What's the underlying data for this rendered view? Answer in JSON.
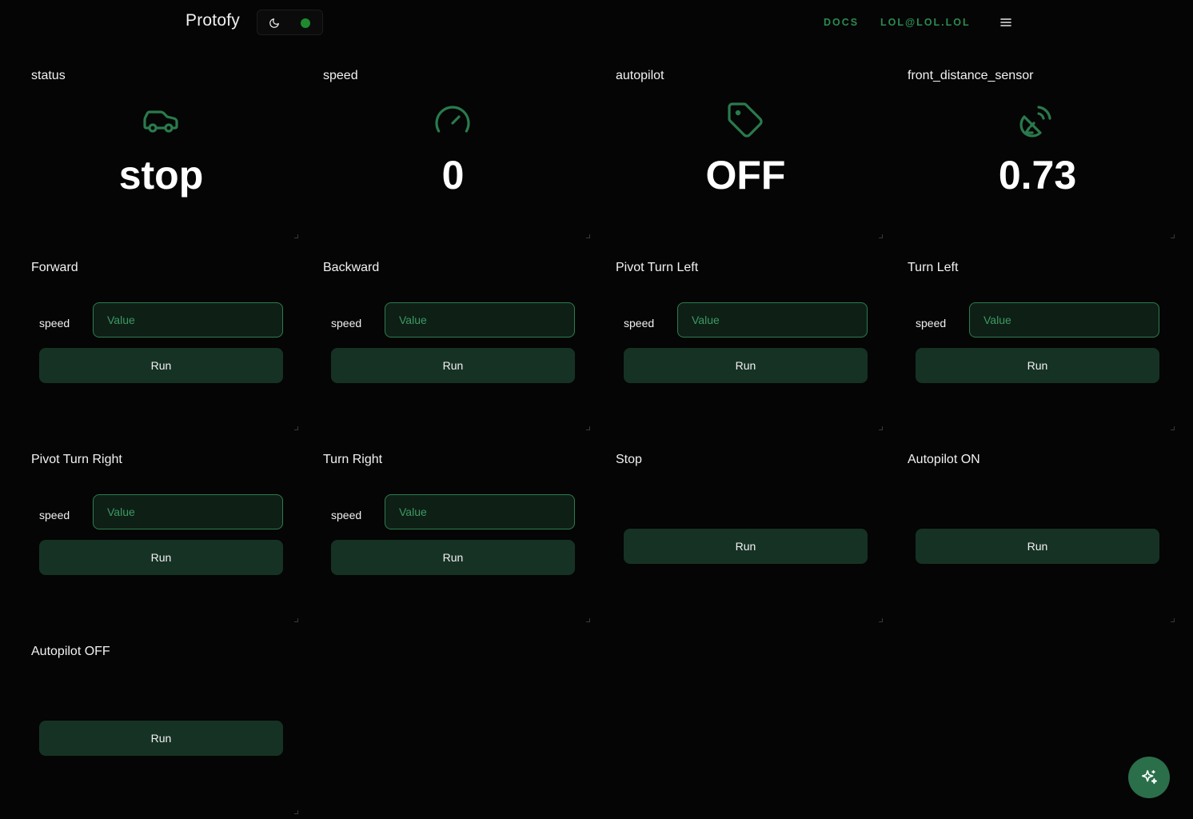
{
  "header": {
    "brand": "Protofy",
    "nav": {
      "docs": "DOCS",
      "user": "LOL@LOL.LOL"
    },
    "icons": {
      "theme": "moon-icon",
      "status": "green-status-dot",
      "menu": "hamburger-menu-icon"
    },
    "status_color": "#1f8a2e"
  },
  "value_cards": [
    {
      "title": "status",
      "icon": "car-icon",
      "value": "stop"
    },
    {
      "title": "speed",
      "icon": "gauge-icon",
      "value": "0"
    },
    {
      "title": "autopilot",
      "icon": "tag-icon",
      "value": "OFF"
    },
    {
      "title": "front_distance_sensor",
      "icon": "satellite-dish-icon",
      "value": "0.73"
    }
  ],
  "action_cards": [
    {
      "title": "Forward",
      "param_label": "speed",
      "placeholder": "Value",
      "run_label": "Run"
    },
    {
      "title": "Backward",
      "param_label": "speed",
      "placeholder": "Value",
      "run_label": "Run"
    },
    {
      "title": "Pivot Turn Left",
      "param_label": "speed",
      "placeholder": "Value",
      "run_label": "Run"
    },
    {
      "title": "Turn Left",
      "param_label": "speed",
      "placeholder": "Value",
      "run_label": "Run"
    },
    {
      "title": "Pivot Turn Right",
      "param_label": "speed",
      "placeholder": "Value",
      "run_label": "Run"
    },
    {
      "title": "Turn Right",
      "param_label": "speed",
      "placeholder": "Value",
      "run_label": "Run"
    },
    {
      "title": "Stop",
      "run_label": "Run"
    },
    {
      "title": "Autopilot ON",
      "run_label": "Run"
    },
    {
      "title": "Autopilot OFF",
      "run_label": "Run"
    }
  ],
  "fab": {
    "icon": "sparkles-icon"
  },
  "colors": {
    "background": "#050505",
    "accent": "#2c8a4f",
    "button": "#163225",
    "input_bg": "#0e1f16",
    "input_border": "#2d7d4f",
    "icon": "#2a7a4c",
    "fab": "#2a6f4a"
  }
}
